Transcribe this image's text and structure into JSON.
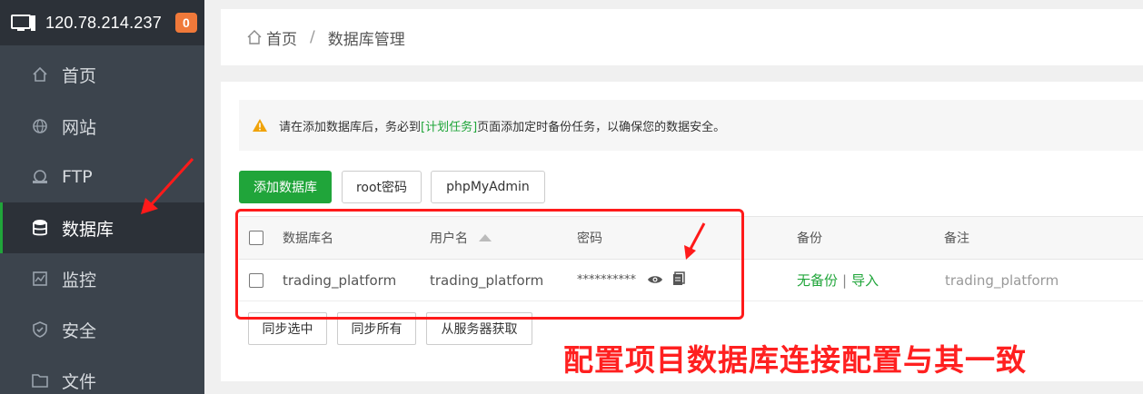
{
  "sidebar": {
    "ip": "120.78.214.237",
    "badge": "0",
    "items": [
      {
        "label": "首页"
      },
      {
        "label": "网站"
      },
      {
        "label": "FTP"
      },
      {
        "label": "数据库"
      },
      {
        "label": "监控"
      },
      {
        "label": "安全"
      },
      {
        "label": "文件"
      }
    ]
  },
  "breadcrumb": {
    "home": "首页",
    "separator": "/",
    "current": "数据库管理"
  },
  "alert": {
    "prefix": "请在添加数据库后，务必到",
    "link": "[计划任务]",
    "suffix": "页面添加定时备份任务，以确保您的数据安全。"
  },
  "toolbar": {
    "add": "添加数据库",
    "root": "root密码",
    "pma": "phpMyAdmin"
  },
  "table": {
    "headers": [
      "数据库名",
      "用户名",
      "密码",
      "备份",
      "备注"
    ],
    "rows": [
      {
        "name": "trading_platform",
        "user": "trading_platform",
        "password": "**********",
        "backup_status": "无备份",
        "backup_sep": "|",
        "import": "导入",
        "note": "trading_platform"
      }
    ]
  },
  "sync": {
    "selected": "同步选中",
    "all": "同步所有",
    "fetch": "从服务器获取"
  },
  "annotation": "配置项目数据库连接配置与其一致",
  "colors": {
    "accent": "#20a53a",
    "badge": "#f0793a",
    "annotation": "#ff2020"
  }
}
